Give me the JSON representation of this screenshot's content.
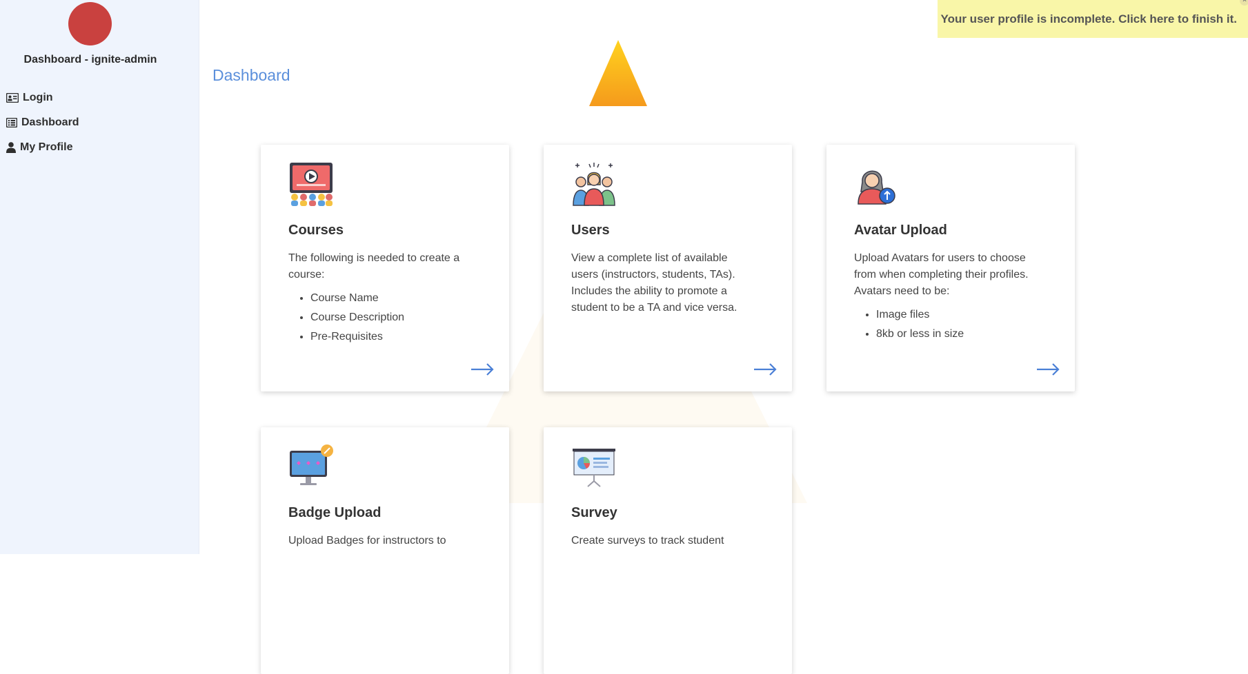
{
  "sidebar": {
    "title": "Dashboard - ignite-admin",
    "avatar_color": "#c9413f",
    "items": [
      {
        "label": "Login",
        "icon": "id-card-icon"
      },
      {
        "label": "Dashboard",
        "icon": "list-icon"
      },
      {
        "label": "My Profile",
        "icon": "user-icon"
      }
    ]
  },
  "header": {
    "title": "Dashboard",
    "accent": "#5b8fdb"
  },
  "notification": {
    "text": "Your user profile is incomplete. Click here to finish it.",
    "close": "×"
  },
  "cards": [
    {
      "title": "Courses",
      "icon": "video-presentation-icon",
      "description": "The following is needed to create a course:",
      "items": [
        "Course Name",
        "Course Description",
        "Pre-Requisites"
      ]
    },
    {
      "title": "Users",
      "icon": "group-users-icon",
      "description": "View a complete list of available users (instructors, students, TAs). Includes the ability to promote a student to be a TA and vice versa.",
      "items": []
    },
    {
      "title": "Avatar Upload",
      "icon": "avatar-upload-icon",
      "description": "Upload Avatars for users to choose from when completing their profiles. Avatars need to be:",
      "items": [
        "Image files",
        "8kb or less in size"
      ]
    },
    {
      "title": "Badge Upload",
      "icon": "badge-monitor-icon",
      "description": "Upload Badges for instructors to",
      "items": []
    },
    {
      "title": "Survey",
      "icon": "survey-board-icon",
      "description": "Create surveys to track student",
      "items": []
    }
  ]
}
